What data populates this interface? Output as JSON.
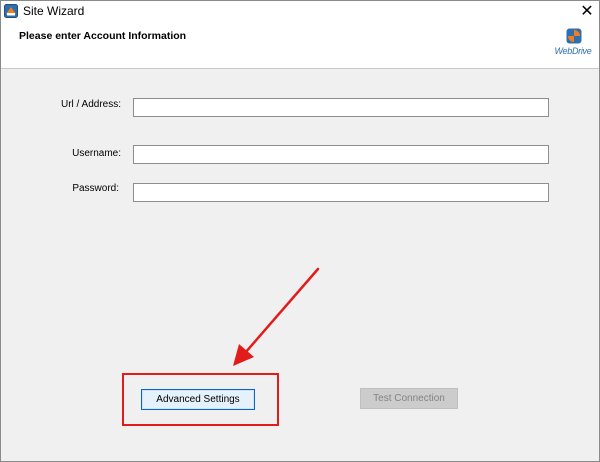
{
  "window": {
    "title": "Site Wizard",
    "close_glyph": "✕"
  },
  "header": {
    "title": "Please enter Account Information",
    "logo_text": "WebDrive"
  },
  "form": {
    "url_label": "Url / Address:",
    "url_value": "",
    "username_label": "Username:",
    "username_value": "",
    "password_label": "Password:",
    "password_value": ""
  },
  "buttons": {
    "advanced_settings": "Advanced Settings",
    "test_connection": "Test Connection",
    "test_connection_enabled": false
  },
  "annotation": {
    "highlight_color": "#e21b1b",
    "highlights": "advanced-settings-button"
  },
  "colors": {
    "logo_blue": "#2e6fae",
    "logo_orange": "#f07d22",
    "button_focus_border": "#0a64c9"
  }
}
